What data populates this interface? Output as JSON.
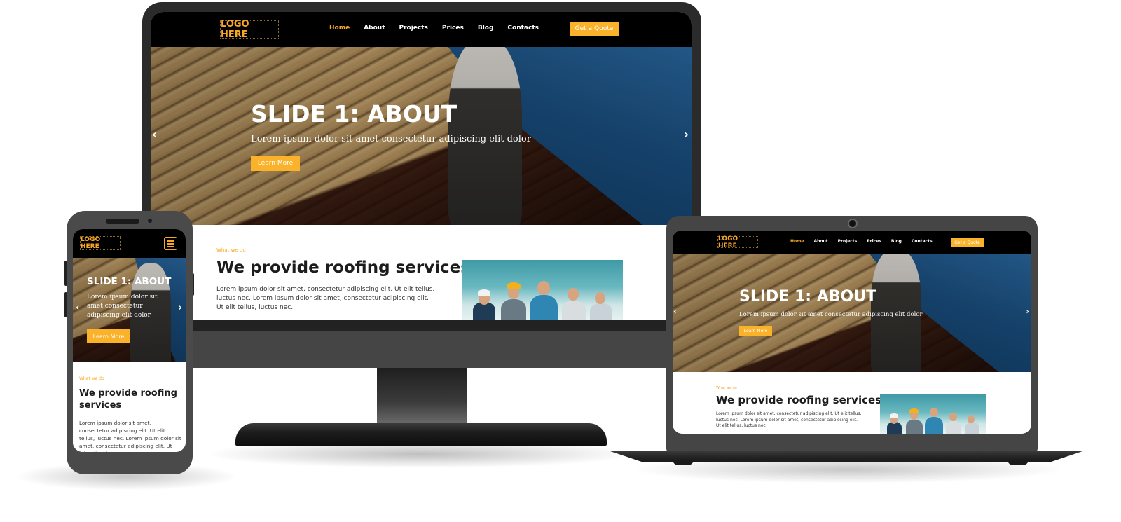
{
  "site": {
    "logo": "LOGO HERE",
    "nav": {
      "items": [
        {
          "label": "Home",
          "active": true
        },
        {
          "label": "About",
          "active": false
        },
        {
          "label": "Projects",
          "active": false
        },
        {
          "label": "Prices",
          "active": false
        },
        {
          "label": "Blog",
          "active": false
        },
        {
          "label": "Contacts",
          "active": false
        }
      ],
      "cta": "Get a Quote"
    },
    "hero": {
      "title": "SLIDE 1: ABOUT",
      "subtitle": "Lorem ipsum dolor sit amet consectetur adipiscing elit dolor",
      "button": "Learn More",
      "prev_icon": "‹",
      "next_icon": "›"
    },
    "services": {
      "eyebrow": "What we do",
      "title": "We provide roofing services",
      "text": "Lorem ipsum dolor sit amet, consectetur adipiscing elit. Ut elit tellus, luctus nec. Lorem ipsum dolor sit amet, consectetur adipiscing elit. Ut elit tellus, luctus nec.",
      "image_alt": "roofing team"
    }
  },
  "colors": {
    "accent": "#fbb22b",
    "nav_bg": "#000000",
    "device_frame": "#454545"
  }
}
